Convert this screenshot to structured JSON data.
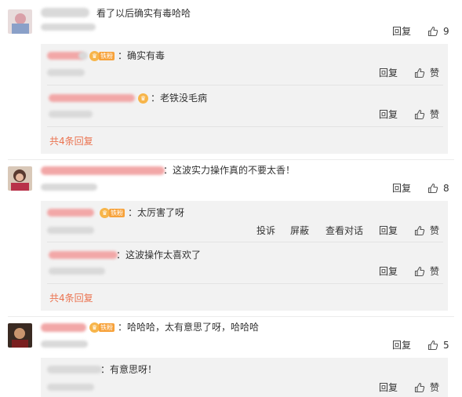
{
  "labels": {
    "reply": "回复",
    "like_text": "赞",
    "report": "投诉",
    "block": "屏蔽",
    "view_dialog": "查看对话",
    "fan_badge": "铁粉"
  },
  "comments": [
    {
      "text": "看了以后确实有毒哈哈",
      "likes": "9",
      "more": "共4条回复",
      "replies": [
        {
          "text": "：确实有毒"
        },
        {
          "text": "：老铁没毛病"
        }
      ]
    },
    {
      "text": "：这波实力操作真的不要太香！",
      "likes": "8",
      "more": "共4条回复",
      "replies": [
        {
          "text": "：太厉害了呀"
        },
        {
          "text": "：这波操作太喜欢了"
        }
      ]
    },
    {
      "text": "：哈哈哈，太有意思了呀，哈哈哈",
      "likes": "5",
      "replies": [
        {
          "text": "：有意思呀！"
        }
      ]
    }
  ],
  "colors": {
    "accent": "#eb7350",
    "panel": "#f2f2f2",
    "badge": "#f7a23b"
  },
  "icons": {
    "like": "thumbs-up-icon",
    "avatar": "avatar"
  }
}
